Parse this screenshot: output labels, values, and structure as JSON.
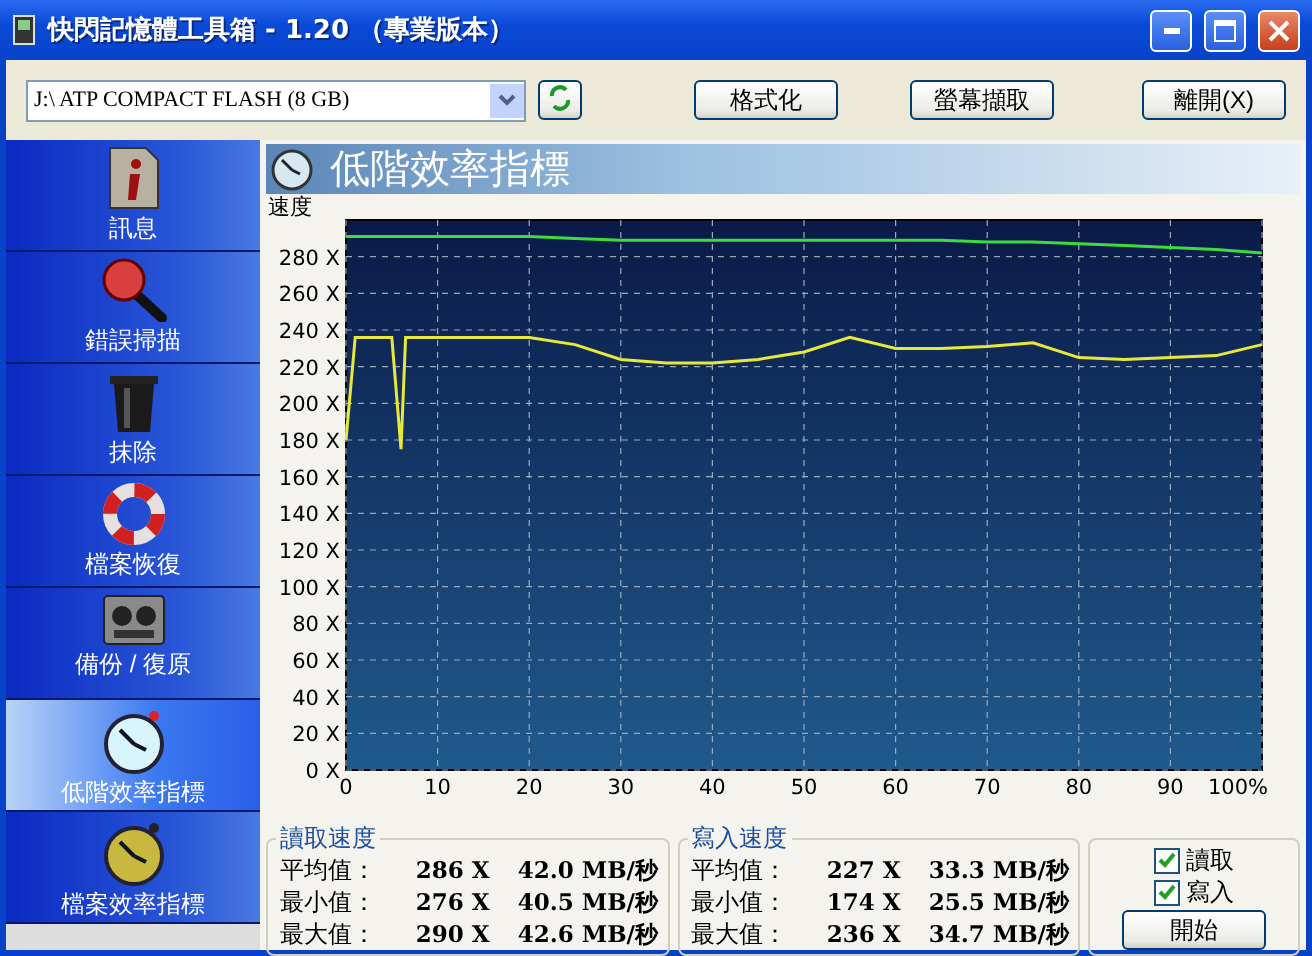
{
  "window": {
    "title": "快閃記憶體工具箱 - 1.20 （專業版本）"
  },
  "toolbar": {
    "drive": {
      "value": "J:\\ ATP COMPACT FLASH (8 GB)"
    },
    "buttons": [
      "格式化",
      "螢幕擷取",
      "離開(X)"
    ]
  },
  "sidebar": {
    "items": [
      {
        "label": "訊息",
        "kind": "info",
        "selected": false
      },
      {
        "label": "錯誤掃描",
        "kind": "magnifier",
        "selected": false
      },
      {
        "label": "抹除",
        "kind": "trash",
        "selected": false
      },
      {
        "label": "檔案恢復",
        "kind": "lifebuoy",
        "selected": false
      },
      {
        "label": "備份 / 復原",
        "kind": "tape",
        "selected": false
      },
      {
        "label": "低階效率指標",
        "kind": "stopwatch",
        "selected": true
      },
      {
        "label": "檔案效率指標",
        "kind": "stopwatch-gold",
        "selected": false
      }
    ]
  },
  "panel": {
    "title": "低階效率指標",
    "chart_data": {
      "type": "line",
      "ylabel": "速度",
      "x": [
        0,
        1,
        5,
        6,
        6.5,
        10,
        15,
        20,
        25,
        30,
        35,
        40,
        45,
        50,
        55,
        60,
        65,
        70,
        75,
        80,
        85,
        90,
        95,
        100
      ],
      "series": [
        {
          "color": "#3ddc3d",
          "values": [
            291,
            291,
            291,
            291,
            291,
            291,
            291,
            291,
            290,
            289,
            289,
            289,
            289,
            289,
            289,
            289,
            289,
            288,
            288,
            287,
            286,
            285,
            284,
            282
          ]
        },
        {
          "color": "#e8e83a",
          "values": [
            180,
            236,
            236,
            175,
            236,
            236,
            236,
            236,
            232,
            224,
            222,
            222,
            224,
            228,
            236,
            230,
            230,
            231,
            233,
            225,
            224,
            225,
            226,
            232
          ]
        }
      ],
      "xlim": [
        0,
        100
      ],
      "ylim": [
        0,
        300
      ],
      "grid": true,
      "xticks": [
        0,
        10,
        20,
        30,
        40,
        50,
        60,
        70,
        80,
        90,
        {
          "value": 100,
          "label": "100%"
        }
      ],
      "yticks": [
        {
          "value": 0,
          "label": "0 X"
        },
        {
          "value": 20,
          "label": "20 X"
        },
        {
          "value": 40,
          "label": "40 X"
        },
        {
          "value": 60,
          "label": "60 X"
        },
        {
          "value": 80,
          "label": "80 X"
        },
        {
          "value": 100,
          "label": "100 X"
        },
        {
          "value": 120,
          "label": "120 X"
        },
        {
          "value": 140,
          "label": "140 X"
        },
        {
          "value": 160,
          "label": "160 X"
        },
        {
          "value": 180,
          "label": "180 X"
        },
        {
          "value": 200,
          "label": "200 X"
        },
        {
          "value": 220,
          "label": "220 X"
        },
        {
          "value": 240,
          "label": "240 X"
        },
        {
          "value": 260,
          "label": "260 X"
        },
        {
          "value": 280,
          "label": "280 X"
        }
      ]
    }
  },
  "stats": [
    {
      "title": "讀取速度",
      "rows": [
        {
          "label": "平均值：",
          "ratio": "286 X",
          "speed": "42.0 MB/秒"
        },
        {
          "label": "最小值：",
          "ratio": "276 X",
          "speed": "40.5 MB/秒"
        },
        {
          "label": "最大值：",
          "ratio": "290 X",
          "speed": "42.6 MB/秒"
        }
      ]
    },
    {
      "title": "寫入速度",
      "rows": [
        {
          "label": "平均值：",
          "ratio": "227 X",
          "speed": "33.3 MB/秒"
        },
        {
          "label": "最小值：",
          "ratio": "174 X",
          "speed": "25.5 MB/秒"
        },
        {
          "label": "最大值：",
          "ratio": "236 X",
          "speed": "34.7 MB/秒"
        }
      ]
    }
  ],
  "options": [
    {
      "label": "讀取",
      "checked": true
    },
    {
      "label": "寫入",
      "checked": true
    }
  ],
  "start_button": "開始"
}
